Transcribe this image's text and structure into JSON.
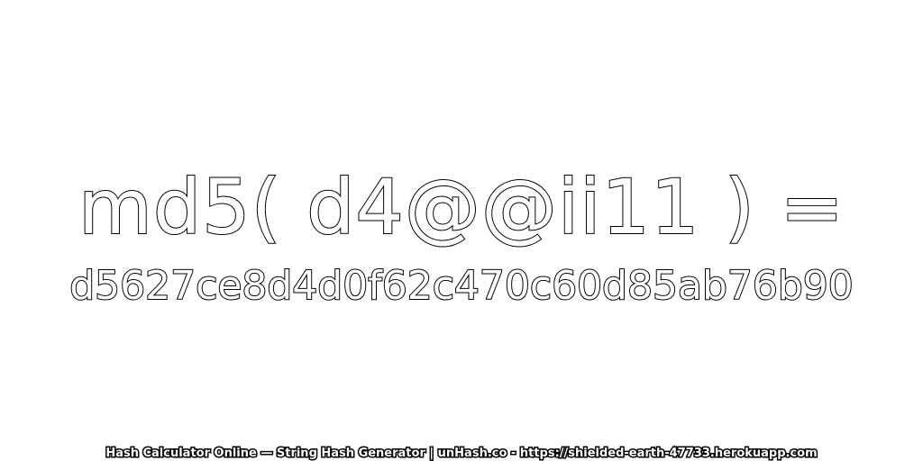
{
  "expression": "md5( d4@@ii11 ) =",
  "hash": "d5627ce8d4d0f62c470c60d85ab76b90",
  "footer": "Hash Calculator Online — String Hash Generator | unHash.co - https://shielded-earth-47733.herokuapp.com",
  "colors": {
    "background": "#ffffff",
    "text_fill": "#ffffff",
    "text_outline": "#000000"
  }
}
